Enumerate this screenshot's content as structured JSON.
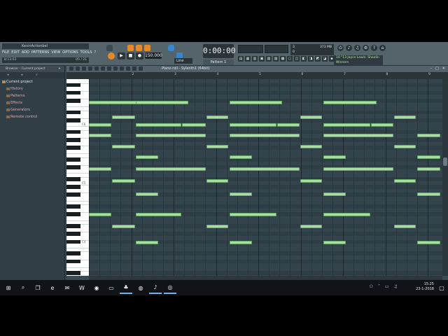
{
  "window": {
    "project_name": "KevinActionbel",
    "menu": [
      "FILE",
      "EDIT",
      "ADD",
      "PATTERNS",
      "VIEW",
      "OPTIONS",
      "TOOLS",
      "?"
    ],
    "hint_left": "8:13:03",
    "hint_right": "05 / 21"
  },
  "transport": {
    "tempo": "150.000",
    "time": "0:00:00",
    "pattern": "Pattern 1",
    "snap": "Line",
    "cpu_top": "3",
    "cpu_mem": "373 MB",
    "cpu_bottom": "0",
    "news_line1": "10 \"13 Jayce Lewis: Shaolin",
    "news_line2": "Winners"
  },
  "browser": {
    "title": "Browser - Current project",
    "items": [
      {
        "label": "Current project",
        "root": true
      },
      {
        "label": "History"
      },
      {
        "label": "Patterns"
      },
      {
        "label": "Effects"
      },
      {
        "label": "Generators"
      },
      {
        "label": "Remote control"
      }
    ]
  },
  "pianoroll": {
    "title": "Piano roll - Sylenth1 (64bit)",
    "bars": [
      "2",
      "3",
      "4",
      "5",
      "6",
      "7",
      "8",
      "9"
    ],
    "key_labels": [
      "C6",
      "C5",
      "C4"
    ]
  },
  "taskbar": {
    "time": "15:25",
    "date": "23-1-2018"
  },
  "colors": {
    "note_fill": "#a8dca5",
    "accent_orange": "#e58a2a"
  }
}
